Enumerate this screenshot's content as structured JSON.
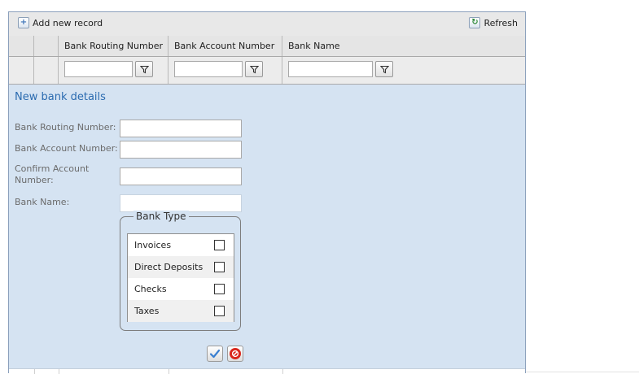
{
  "toolbar": {
    "add_label": "Add new record",
    "refresh_label": "Refresh"
  },
  "columns": [
    "Bank Routing Number",
    "Bank Account Number",
    "Bank Name"
  ],
  "filters": [
    {
      "value": "",
      "placeholder": ""
    },
    {
      "value": "",
      "placeholder": ""
    },
    {
      "value": "",
      "placeholder": ""
    }
  ],
  "form": {
    "title": "New bank details",
    "routing_label": "Bank Routing Number:",
    "account_label": "Bank Account Number:",
    "confirm_label": "Confirm Account Number:",
    "bank_name_label": "Bank Name:",
    "routing_value": "",
    "account_value": "",
    "confirm_value": "",
    "bank_name_value": "",
    "bank_type": {
      "legend": "Bank Type",
      "options": [
        {
          "label": "Invoices",
          "checked": false
        },
        {
          "label": "Direct Deposits",
          "checked": false
        },
        {
          "label": "Checks",
          "checked": false
        },
        {
          "label": "Taxes",
          "checked": false
        }
      ]
    }
  },
  "colors": {
    "form_background": "#d5e3f2",
    "title_blue": "#2b6bb0",
    "header_gray": "#e5e5e5",
    "cancel_red": "#d9261c",
    "save_blue": "#3a7fd0",
    "refresh_green": "#2f8a3a"
  },
  "icons": {
    "add": "plus-icon",
    "refresh": "refresh-icon",
    "filter": "filter-icon",
    "save": "checkmark-icon",
    "cancel": "cancel-icon"
  }
}
